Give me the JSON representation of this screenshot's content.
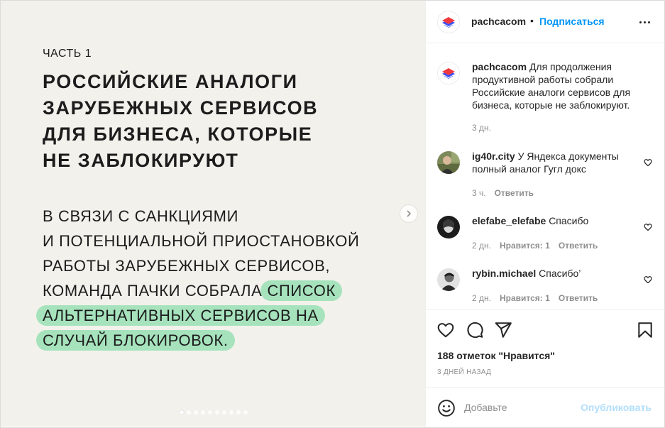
{
  "slide": {
    "part_label": "ЧАСТЬ 1",
    "headline_lines": [
      "РОССИЙСКИЕ АНАЛОГИ",
      "ЗАРУБЕЖНЫХ СЕРВИСОВ",
      "ДЛЯ БИЗНЕСА, КОТОРЫЕ",
      "НЕ ЗАБЛОКИРУЮТ"
    ],
    "body_lines": [
      "В СВЯЗИ С САНКЦИЯМИ",
      "И ПОТЕНЦИАЛЬНОЙ ПРИОСТАНОВКОЙ",
      "РАБОТЫ ЗАРУБЕЖНЫХ СЕРВИСОВ,",
      "КОМАНДА ПАЧКИ СОБРАЛА"
    ],
    "highlight_lines": [
      "СПИСОК",
      "АЛЬТЕРНАТИВНЫХ СЕРВИСОВ НА",
      "СЛУЧАЙ БЛОКИРОВОК."
    ],
    "highlight_color": "#a6e3bd",
    "background_color": "#f3f1ec",
    "carousel_count": 10,
    "carousel_active": 1
  },
  "header": {
    "username": "pachcacom",
    "separator": "•",
    "follow_label": "Подписаться",
    "more_icon": "more-horizontal-icon"
  },
  "caption": {
    "username": "pachcacom",
    "text": "Для продолжения продуктивной работы собрали Российские аналоги сервисов для бизнеса, которые не заблокируют.",
    "time": "3 дн."
  },
  "comments": [
    {
      "username": "ig40r.city",
      "text": "У Яндекса документы полный аналог Гугл докс",
      "time": "3 ч.",
      "likes": "",
      "reply": "Ответить"
    },
    {
      "username": "elefabe_elefabe",
      "text": "Спасибо",
      "time": "2 дн.",
      "likes": "Нравится: 1",
      "reply": "Ответить"
    },
    {
      "username": "rybin.michael",
      "text": "Спасибо’",
      "time": "2 дн.",
      "likes": "Нравится: 1",
      "reply": "Ответить"
    }
  ],
  "actions": {
    "likes": "188 отметок \"Нравится\"",
    "date": "3 ДНЕЙ НАЗАД"
  },
  "add_comment": {
    "placeholder": "Добавьте",
    "publish_label": "Опубликовать"
  },
  "colors": {
    "accent": "#0095f6",
    "publish_disabled": "#b2dffc",
    "logo_red": "#f0383f",
    "logo_blue": "#3b4ff2"
  }
}
